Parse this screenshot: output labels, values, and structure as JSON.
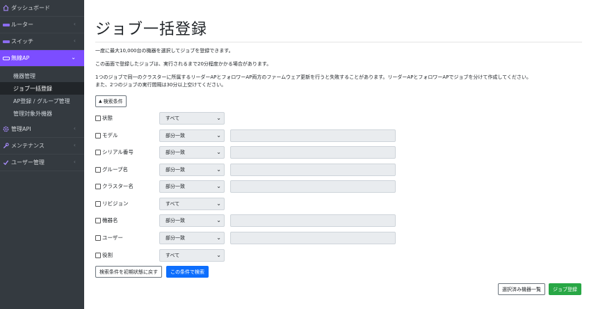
{
  "sidebar": {
    "dashboard": "ダッシュボード",
    "router": "ルーター",
    "switch": "スイッチ",
    "wireless_ap": "無線AP",
    "submenu": [
      "機器管理",
      "ジョブ一括登録",
      "AP登録 / グループ管理",
      "管理対象外機器"
    ],
    "management_api": "管理API",
    "maintenance": "メンテナンス",
    "user_management": "ユーザー管理"
  },
  "main": {
    "title": "ジョブ一括登録",
    "desc1": "一度に最大10,000台の機器を選択してジョブを登録できます。",
    "desc2": "この画面で登録したジョブは、実行されるまで20分程度かかる場合があります。",
    "desc3": "1つのジョブで同一のクラスターに所属するリーダーAPとフォロワーAP両方のファームウェア更新を行うと失敗することがあります。リーダーAPとフォロワーAPでジョブを分けて作成してください。",
    "desc4": "また、2つのジョブの実行間隔は30分以上空けてください。",
    "search_toggle": "検索条件",
    "filters": [
      {
        "label": "状態",
        "select": "すべて"
      },
      {
        "label": "モデル",
        "select": "部分一致"
      },
      {
        "label": "シリアル番号",
        "select": "部分一致"
      },
      {
        "label": "グループ名",
        "select": "部分一致"
      },
      {
        "label": "クラスター名",
        "select": "部分一致"
      },
      {
        "label": "リビジョン",
        "select": "すべて"
      },
      {
        "label": "機器名",
        "select": "部分一致"
      },
      {
        "label": "ユーザー",
        "select": "部分一致"
      },
      {
        "label": "役割",
        "select": "すべて"
      }
    ],
    "reset_button": "検索条件を初期状態に戻す",
    "search_button": "この条件で検索",
    "selected_list_button": "選択済み機器一覧",
    "register_button": "ジョブ登録"
  },
  "colors": {
    "sidebar_bg": "#343a40",
    "active_accent": "#7c4dff",
    "primary": "#0d6efd",
    "success": "#28a745"
  }
}
